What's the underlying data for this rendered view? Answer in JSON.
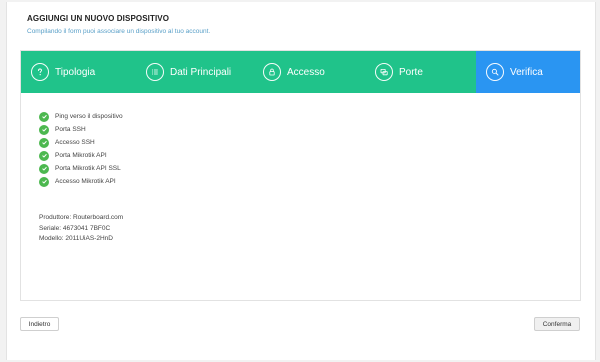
{
  "page": {
    "title": "AGGIUNGI UN NUOVO DISPOSITIVO",
    "subtitle": "Compilando il form puoi associare un dispositivo al tuo account."
  },
  "wizard": {
    "steps": [
      {
        "label": "Tipologia",
        "icon": "question-icon",
        "active": false
      },
      {
        "label": "Dati Principali",
        "icon": "list-icon",
        "active": false
      },
      {
        "label": "Accesso",
        "icon": "lock-icon",
        "active": false
      },
      {
        "label": "Porte",
        "icon": "ports-icon",
        "active": false
      },
      {
        "label": "Verifica",
        "icon": "search-icon",
        "active": true
      }
    ],
    "checks": [
      "Ping verso il dispositivo",
      "Porta SSH",
      "Accesso SSH",
      "Porta Mikrotik API",
      "Porta Mikrotik API SSL",
      "Accesso Mikrotik API"
    ],
    "device_info": {
      "producer": "Produttore: Routerboard.com",
      "serial": "Seriale: 4673041 7BF0C",
      "model": "Modello: 2011UiAS-2HnD"
    }
  },
  "buttons": {
    "back": "Indietro",
    "confirm": "Conferma"
  },
  "colors": {
    "step_done": "#20c38a",
    "step_active": "#2a95f2",
    "check": "#4cb84f",
    "subtitle": "#5aa0c8"
  }
}
